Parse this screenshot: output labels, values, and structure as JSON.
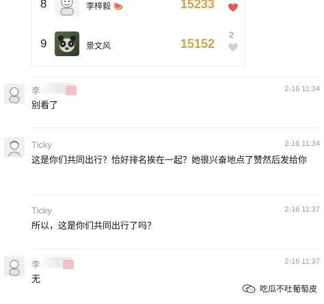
{
  "leaderboard": {
    "rows": [
      {
        "rank": "8",
        "name": "李梓毅",
        "name_emoji": "🍉",
        "steps": "15233",
        "likes": "",
        "liked": true
      },
      {
        "rank": "9",
        "name": "景文风",
        "steps": "15152",
        "likes": "2",
        "liked": false
      }
    ]
  },
  "comments": [
    {
      "user": "李",
      "time": "2-16 11:34",
      "text": "别看了",
      "has_avatar": true,
      "avatar_icon": "person-icon"
    },
    {
      "user": "Ticky",
      "time": "2-16 11:34",
      "text": "这是你们共同出行？恰好排名挨在一起？她很兴奋地点了赞然后发给你",
      "has_avatar": true,
      "avatar_icon": "person-icon"
    },
    {
      "user": "Ticky",
      "time": "2-16 11:37",
      "text": "所以，这是你们共同出行了吗？",
      "has_avatar": false
    },
    {
      "user": "李",
      "time": "2-16 11:37",
      "text": "无",
      "has_avatar": true,
      "avatar_icon": "person-icon"
    }
  ],
  "watermark": {
    "text": "吃瓜不吐葡萄皮",
    "icon": "wechat-icon"
  },
  "colors": {
    "step_gold": "#c9a646",
    "heart_red": "#e05a5a",
    "heart_gray": "#d2d2d2",
    "meta_gray": "#9a9a9a"
  }
}
